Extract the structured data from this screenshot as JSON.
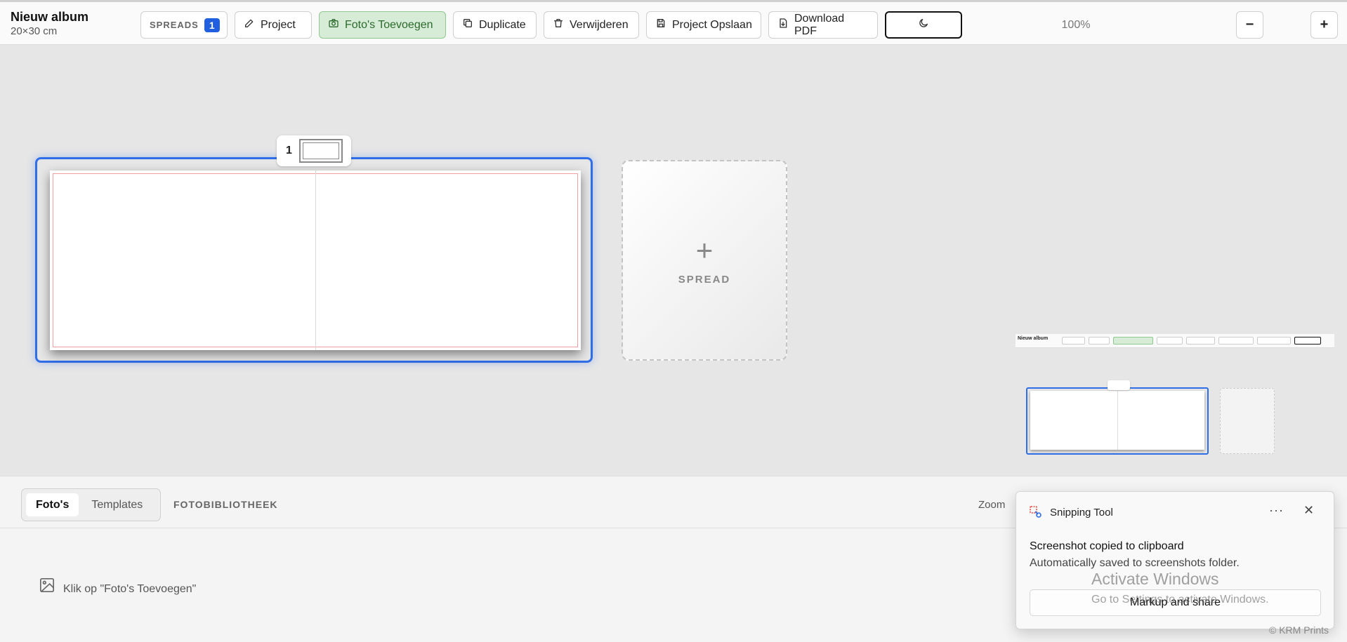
{
  "album": {
    "title": "Nieuw album",
    "size": "20×30 cm"
  },
  "toolbar": {
    "spreads_label": "SPREADS",
    "spreads_count": "1",
    "project_label": "Project",
    "add_photos_label": "Foto's Toevoegen",
    "duplicate_label": "Duplicate",
    "delete_label": "Verwijderen",
    "save_label": "Project Opslaan",
    "download_label": "Download PDF",
    "zoom_out": "−",
    "zoom_level": "100%",
    "zoom_in": "+"
  },
  "canvas": {
    "spread_number": "1",
    "add_spread_plus": "+",
    "add_spread_label": "SPREAD"
  },
  "panel": {
    "tabs": [
      {
        "label": "Foto's",
        "active": true
      },
      {
        "label": "Templates",
        "active": false
      }
    ],
    "library_label": "FOTOBIBLIOTHEEK",
    "zoom_label": "Zoom",
    "empty_hint": "Klik op \"Foto's Toevoegen\""
  },
  "notification": {
    "app_name": "Snipping Tool",
    "title": "Screenshot copied to clipboard",
    "message": "Automatically saved to screenshots folder.",
    "action_label": "Markup and share",
    "more_label": "···",
    "close_label": "✕"
  },
  "watermark": {
    "title": "Activate Windows",
    "subtitle": "Go to Settings to activate Windows."
  },
  "footer": {
    "credit": "© KRM Prints"
  },
  "colors": {
    "accent": "#2f6ee8",
    "badge": "#1f5fe0",
    "green_bg": "#d6ecd6",
    "green_text": "#2c6a2c",
    "bleed": "#f0a0a0"
  }
}
